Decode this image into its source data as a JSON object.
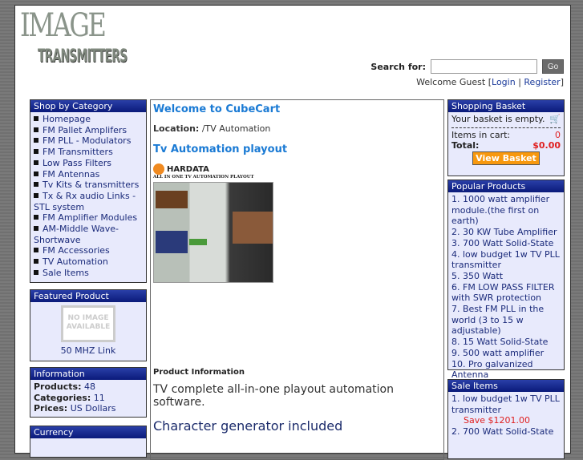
{
  "logo": {
    "line1": "IMAGE",
    "line2": "TRANSMITTERS"
  },
  "search": {
    "label": "Search for:",
    "value": "",
    "button": "Go"
  },
  "welcome": {
    "text": "Welcome Guest [",
    "login": "Login",
    "sep": " | ",
    "register": "Register",
    "end": "]"
  },
  "categories": {
    "title": "Shop by Category",
    "items": [
      "Homepage",
      "FM Pallet Amplifers",
      "FM PLL - Modulators",
      "FM Transmitters",
      "Low Pass Filters",
      "FM Antennas",
      "Tv Kits & transmitters",
      "Tx & Rx audio Links -STL system",
      "FM Amplifier Modules",
      "AM-Middle Wave-Shortwave",
      "FM Accessories",
      "TV Automation",
      "Sale Items"
    ]
  },
  "featured": {
    "title": "Featured Product",
    "image_text": "NO IMAGE AVAILABLE",
    "product": "50 MHZ Link"
  },
  "information": {
    "title": "Information",
    "products_label": "Products:",
    "products": "48",
    "categories_label": "Categories:",
    "categories": "11",
    "prices_label": "Prices:",
    "prices": "US Dollars"
  },
  "currency": {
    "title": "Currency"
  },
  "main": {
    "welcome": "Welcome to CubeCart",
    "location_label": "Location:",
    "location": "/TV Automation",
    "product_title": "Tv Automation playout",
    "image_brand": "HARDATA",
    "image_tagline": "ALL IN ONE TV AUTOMATION PLAYOUT",
    "product_info": "Product Information",
    "description": "TV complete all-in-one playout automation software.",
    "feature": "Character generator included"
  },
  "basket": {
    "title": "Shopping Basket",
    "empty": "Your basket is empty.",
    "items_label": "Items in cart:",
    "items": "0",
    "total_label": "Total:",
    "total": "$0.00",
    "button": "View Basket"
  },
  "popular": {
    "title": "Popular Products",
    "items": [
      "1. 1000 watt amplifier module.(the first on earth)",
      "2. 30 KW Tube Amplifier",
      "3. 700 Watt Solid-State",
      "4. low budget 1w TV PLL transmitter",
      "5. 350 Watt",
      "6. FM LOW PASS FILTER with SWR protection",
      "7. Best FM PLL in the world (3 to 15 w adjustable)",
      "8. 15 Watt Solid-State",
      "9. 500 watt amplifier",
      "10. Pro galvanized Antenna"
    ]
  },
  "sale": {
    "title": "Sale Items",
    "items": [
      {
        "name": "1. low budget 1w TV PLL transmitter",
        "save": "Save $1201.00"
      },
      {
        "name": "2. 700 Watt Solid-State"
      }
    ]
  }
}
